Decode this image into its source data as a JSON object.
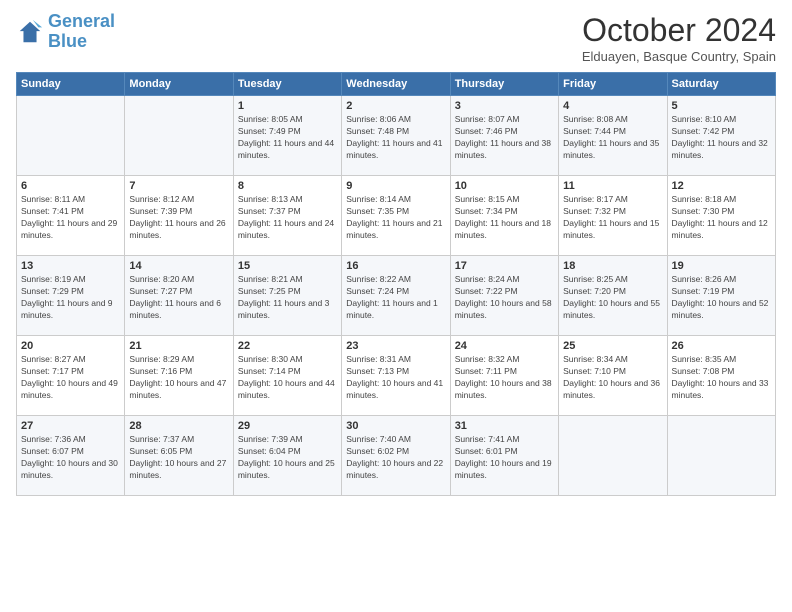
{
  "logo": {
    "line1": "General",
    "line2": "Blue"
  },
  "header": {
    "month": "October 2024",
    "location": "Elduayen, Basque Country, Spain"
  },
  "weekdays": [
    "Sunday",
    "Monday",
    "Tuesday",
    "Wednesday",
    "Thursday",
    "Friday",
    "Saturday"
  ],
  "weeks": [
    [
      {
        "day": "",
        "sunrise": "",
        "sunset": "",
        "daylight": ""
      },
      {
        "day": "",
        "sunrise": "",
        "sunset": "",
        "daylight": ""
      },
      {
        "day": "1",
        "sunrise": "Sunrise: 8:05 AM",
        "sunset": "Sunset: 7:49 PM",
        "daylight": "Daylight: 11 hours and 44 minutes."
      },
      {
        "day": "2",
        "sunrise": "Sunrise: 8:06 AM",
        "sunset": "Sunset: 7:48 PM",
        "daylight": "Daylight: 11 hours and 41 minutes."
      },
      {
        "day": "3",
        "sunrise": "Sunrise: 8:07 AM",
        "sunset": "Sunset: 7:46 PM",
        "daylight": "Daylight: 11 hours and 38 minutes."
      },
      {
        "day": "4",
        "sunrise": "Sunrise: 8:08 AM",
        "sunset": "Sunset: 7:44 PM",
        "daylight": "Daylight: 11 hours and 35 minutes."
      },
      {
        "day": "5",
        "sunrise": "Sunrise: 8:10 AM",
        "sunset": "Sunset: 7:42 PM",
        "daylight": "Daylight: 11 hours and 32 minutes."
      }
    ],
    [
      {
        "day": "6",
        "sunrise": "Sunrise: 8:11 AM",
        "sunset": "Sunset: 7:41 PM",
        "daylight": "Daylight: 11 hours and 29 minutes."
      },
      {
        "day": "7",
        "sunrise": "Sunrise: 8:12 AM",
        "sunset": "Sunset: 7:39 PM",
        "daylight": "Daylight: 11 hours and 26 minutes."
      },
      {
        "day": "8",
        "sunrise": "Sunrise: 8:13 AM",
        "sunset": "Sunset: 7:37 PM",
        "daylight": "Daylight: 11 hours and 24 minutes."
      },
      {
        "day": "9",
        "sunrise": "Sunrise: 8:14 AM",
        "sunset": "Sunset: 7:35 PM",
        "daylight": "Daylight: 11 hours and 21 minutes."
      },
      {
        "day": "10",
        "sunrise": "Sunrise: 8:15 AM",
        "sunset": "Sunset: 7:34 PM",
        "daylight": "Daylight: 11 hours and 18 minutes."
      },
      {
        "day": "11",
        "sunrise": "Sunrise: 8:17 AM",
        "sunset": "Sunset: 7:32 PM",
        "daylight": "Daylight: 11 hours and 15 minutes."
      },
      {
        "day": "12",
        "sunrise": "Sunrise: 8:18 AM",
        "sunset": "Sunset: 7:30 PM",
        "daylight": "Daylight: 11 hours and 12 minutes."
      }
    ],
    [
      {
        "day": "13",
        "sunrise": "Sunrise: 8:19 AM",
        "sunset": "Sunset: 7:29 PM",
        "daylight": "Daylight: 11 hours and 9 minutes."
      },
      {
        "day": "14",
        "sunrise": "Sunrise: 8:20 AM",
        "sunset": "Sunset: 7:27 PM",
        "daylight": "Daylight: 11 hours and 6 minutes."
      },
      {
        "day": "15",
        "sunrise": "Sunrise: 8:21 AM",
        "sunset": "Sunset: 7:25 PM",
        "daylight": "Daylight: 11 hours and 3 minutes."
      },
      {
        "day": "16",
        "sunrise": "Sunrise: 8:22 AM",
        "sunset": "Sunset: 7:24 PM",
        "daylight": "Daylight: 11 hours and 1 minute."
      },
      {
        "day": "17",
        "sunrise": "Sunrise: 8:24 AM",
        "sunset": "Sunset: 7:22 PM",
        "daylight": "Daylight: 10 hours and 58 minutes."
      },
      {
        "day": "18",
        "sunrise": "Sunrise: 8:25 AM",
        "sunset": "Sunset: 7:20 PM",
        "daylight": "Daylight: 10 hours and 55 minutes."
      },
      {
        "day": "19",
        "sunrise": "Sunrise: 8:26 AM",
        "sunset": "Sunset: 7:19 PM",
        "daylight": "Daylight: 10 hours and 52 minutes."
      }
    ],
    [
      {
        "day": "20",
        "sunrise": "Sunrise: 8:27 AM",
        "sunset": "Sunset: 7:17 PM",
        "daylight": "Daylight: 10 hours and 49 minutes."
      },
      {
        "day": "21",
        "sunrise": "Sunrise: 8:29 AM",
        "sunset": "Sunset: 7:16 PM",
        "daylight": "Daylight: 10 hours and 47 minutes."
      },
      {
        "day": "22",
        "sunrise": "Sunrise: 8:30 AM",
        "sunset": "Sunset: 7:14 PM",
        "daylight": "Daylight: 10 hours and 44 minutes."
      },
      {
        "day": "23",
        "sunrise": "Sunrise: 8:31 AM",
        "sunset": "Sunset: 7:13 PM",
        "daylight": "Daylight: 10 hours and 41 minutes."
      },
      {
        "day": "24",
        "sunrise": "Sunrise: 8:32 AM",
        "sunset": "Sunset: 7:11 PM",
        "daylight": "Daylight: 10 hours and 38 minutes."
      },
      {
        "day": "25",
        "sunrise": "Sunrise: 8:34 AM",
        "sunset": "Sunset: 7:10 PM",
        "daylight": "Daylight: 10 hours and 36 minutes."
      },
      {
        "day": "26",
        "sunrise": "Sunrise: 8:35 AM",
        "sunset": "Sunset: 7:08 PM",
        "daylight": "Daylight: 10 hours and 33 minutes."
      }
    ],
    [
      {
        "day": "27",
        "sunrise": "Sunrise: 7:36 AM",
        "sunset": "Sunset: 6:07 PM",
        "daylight": "Daylight: 10 hours and 30 minutes."
      },
      {
        "day": "28",
        "sunrise": "Sunrise: 7:37 AM",
        "sunset": "Sunset: 6:05 PM",
        "daylight": "Daylight: 10 hours and 27 minutes."
      },
      {
        "day": "29",
        "sunrise": "Sunrise: 7:39 AM",
        "sunset": "Sunset: 6:04 PM",
        "daylight": "Daylight: 10 hours and 25 minutes."
      },
      {
        "day": "30",
        "sunrise": "Sunrise: 7:40 AM",
        "sunset": "Sunset: 6:02 PM",
        "daylight": "Daylight: 10 hours and 22 minutes."
      },
      {
        "day": "31",
        "sunrise": "Sunrise: 7:41 AM",
        "sunset": "Sunset: 6:01 PM",
        "daylight": "Daylight: 10 hours and 19 minutes."
      },
      {
        "day": "",
        "sunrise": "",
        "sunset": "",
        "daylight": ""
      },
      {
        "day": "",
        "sunrise": "",
        "sunset": "",
        "daylight": ""
      }
    ]
  ]
}
